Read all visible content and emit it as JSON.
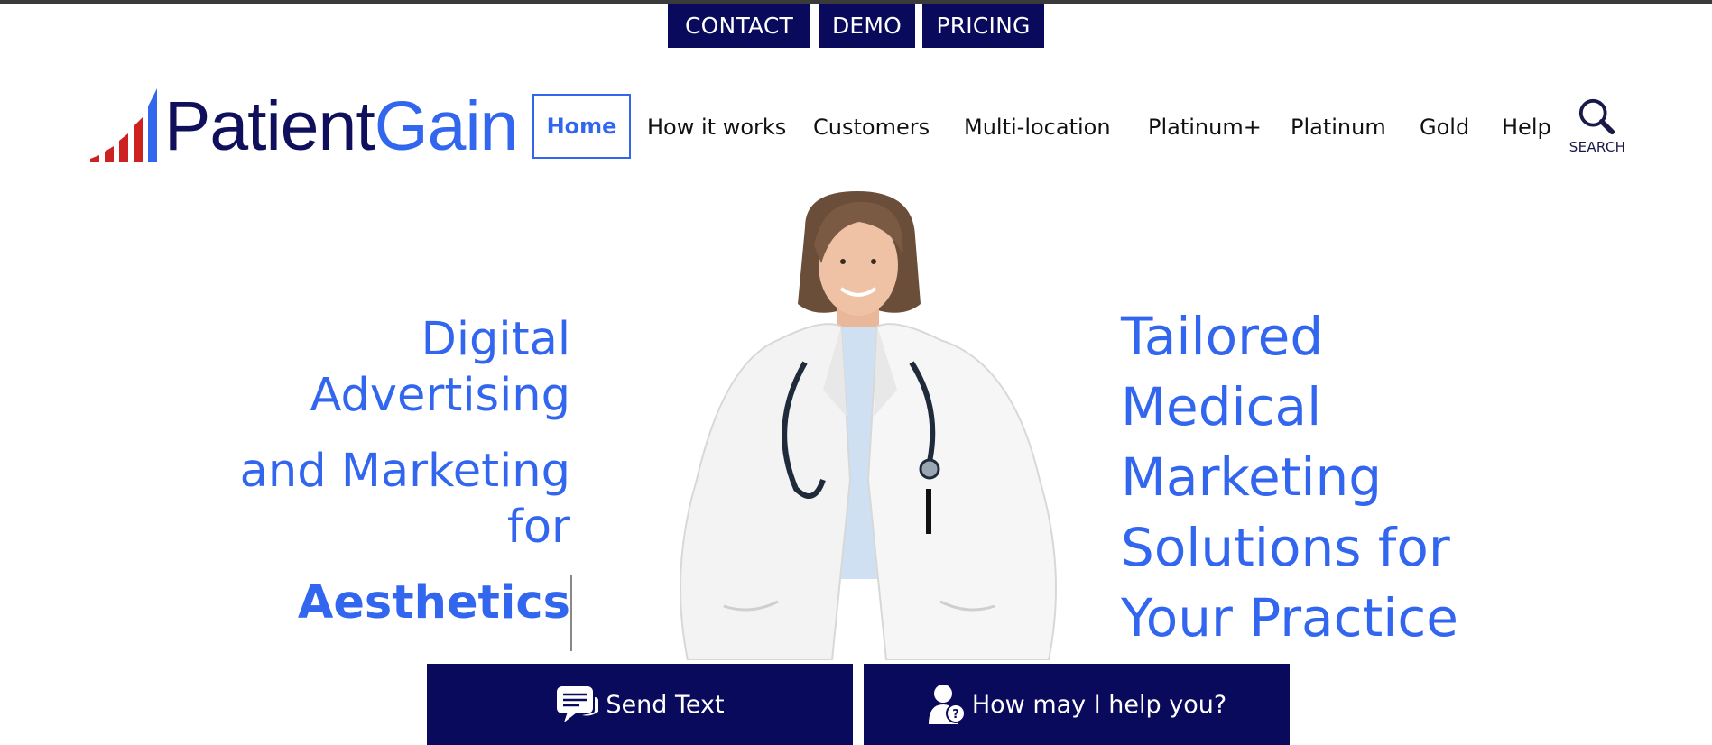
{
  "top_links": {
    "contact": "CONTACT",
    "demo": "DEMO",
    "pricing": "PRICING"
  },
  "logo": {
    "part1": "Patient",
    "part2": "Gain",
    "colors": {
      "dark": "#0f0f5c",
      "accent": "#3366ee",
      "bars": "#cc2222"
    }
  },
  "nav": {
    "home": "Home",
    "items": [
      "How it works",
      "Customers",
      "Multi-location",
      "Platinum+",
      "Platinum",
      "Gold",
      "Help"
    ],
    "search_label": "SEARCH"
  },
  "hero": {
    "left_lines": [
      "Digital",
      "Advertising",
      "and Marketing",
      "for"
    ],
    "left_highlight": "Aesthetics",
    "right_lines": [
      "Tailored",
      "Medical",
      "Marketing",
      "Solutions for",
      "Your Practice"
    ]
  },
  "bottom": {
    "send_text": "Send Text",
    "help": "How may I help you?"
  },
  "colors": {
    "navy": "#0a0a5c",
    "accent": "#3366ee"
  }
}
